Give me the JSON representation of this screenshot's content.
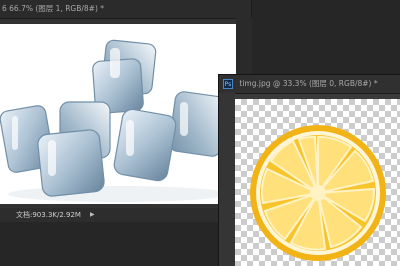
{
  "ice_window": {
    "tab_title": "6 66.7% (图层 1, RGB/8#) *",
    "status_text": "文档:903.3K/2.92M",
    "status_arrow": "▶"
  },
  "lemon_window": {
    "icon_text": "Ps",
    "tab_title": "timg.jpg @ 33.3% (图层 0, RGB/8#) *"
  },
  "colors": {
    "app_background": "#262626",
    "lemon_peel": "#f2b316",
    "lemon_flesh": "#f7c52b",
    "pith": "#fff6d8"
  }
}
